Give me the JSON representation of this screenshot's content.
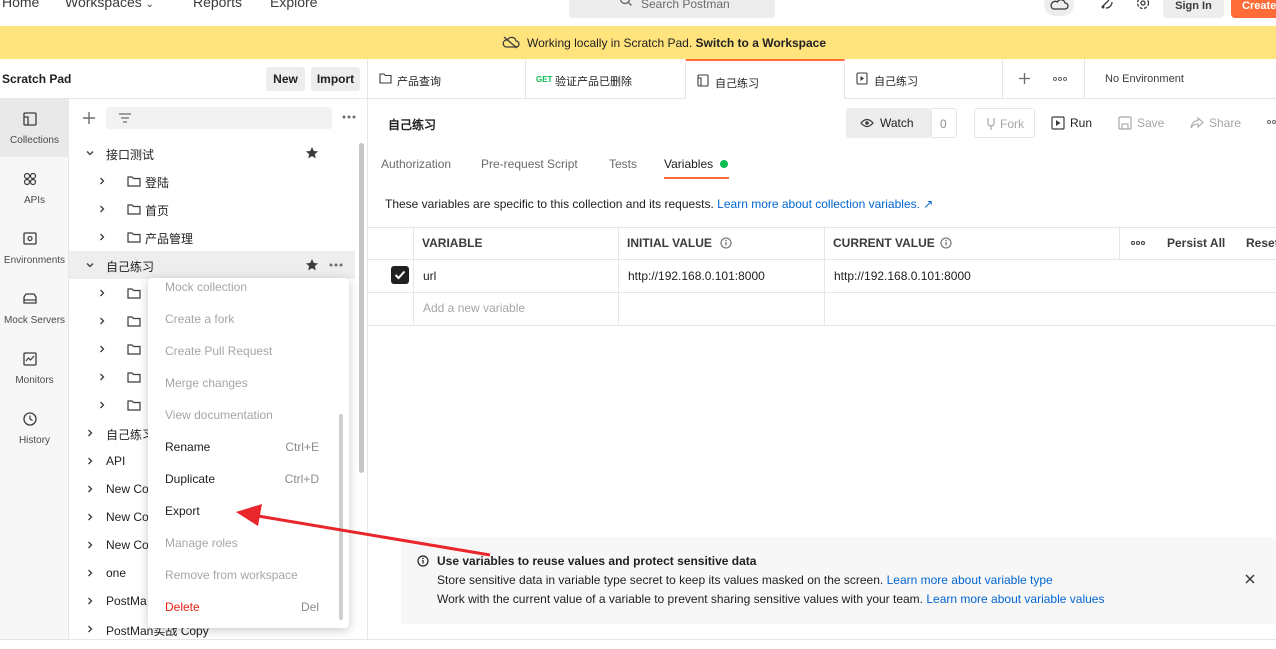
{
  "colors": {
    "accent": "#ff6c37",
    "banner": "#ffe47e",
    "link": "#0265d2",
    "success": "#0cbb52",
    "danger": "#eb2013",
    "annotation_arrow": "#e8262c"
  },
  "nav": {
    "home": "Home",
    "workspaces": "Workspaces",
    "reports": "Reports",
    "explore": "Explore",
    "search_placeholder": "Search Postman",
    "sign_in": "Sign In",
    "create": "Create"
  },
  "banner": {
    "text": "Working locally in Scratch Pad.",
    "link": "Switch to a Workspace"
  },
  "sidebar": {
    "title": "Scratch Pad",
    "new_label": "New",
    "import_label": "Import",
    "rail": [
      {
        "label": "Collections",
        "icon": "collections-icon"
      },
      {
        "label": "APIs",
        "icon": "apis-icon"
      },
      {
        "label": "Environments",
        "icon": "environments-icon"
      },
      {
        "label": "Mock Servers",
        "icon": "mock-servers-icon"
      },
      {
        "label": "Monitors",
        "icon": "monitors-icon"
      },
      {
        "label": "History",
        "icon": "history-icon"
      }
    ],
    "tree": [
      {
        "label": "接口测试"
      },
      {
        "label": "登陆"
      },
      {
        "label": "首页"
      },
      {
        "label": "产品管理"
      },
      {
        "label": "自己练习"
      },
      {
        "label": "自己练习"
      },
      {
        "label": "API"
      },
      {
        "label": "New Co"
      },
      {
        "label": "New Co"
      },
      {
        "label": "New Co"
      },
      {
        "label": "one"
      },
      {
        "label": "PostMa"
      },
      {
        "label": "PostMan实战 Copy"
      }
    ]
  },
  "context_menu": {
    "items": [
      {
        "label": "Mock collection",
        "shortcut": ""
      },
      {
        "label": "Create a fork",
        "shortcut": ""
      },
      {
        "label": "Create Pull Request",
        "shortcut": ""
      },
      {
        "label": "Merge changes",
        "shortcut": ""
      },
      {
        "label": "View documentation",
        "shortcut": ""
      },
      {
        "label": "Rename",
        "shortcut": "Ctrl+E"
      },
      {
        "label": "Duplicate",
        "shortcut": "Ctrl+D"
      },
      {
        "label": "Export",
        "shortcut": ""
      },
      {
        "label": "Manage roles",
        "shortcut": ""
      },
      {
        "label": "Remove from workspace",
        "shortcut": ""
      },
      {
        "label": "Delete",
        "shortcut": "Del"
      }
    ]
  },
  "tabs": [
    {
      "label": "产品查询",
      "method": ""
    },
    {
      "label": "验证产品已删除",
      "method": "GET"
    },
    {
      "label": "自己练习",
      "method": ""
    },
    {
      "label": "自己练习",
      "method": ""
    }
  ],
  "environment": "No Environment",
  "collection": {
    "title": "自己练习",
    "watch": "Watch",
    "watch_count": "0",
    "fork": "Fork",
    "run": "Run",
    "save": "Save",
    "share": "Share"
  },
  "inner_tabs": {
    "authorization": "Authorization",
    "prerequest": "Pre-request Script",
    "tests": "Tests",
    "variables": "Variables"
  },
  "variables": {
    "description": "These variables are specific to this collection and its requests.",
    "learn_more": "Learn more about collection variables. ↗",
    "headers": {
      "variable": "VARIABLE",
      "initial": "INITIAL VALUE",
      "current": "CURRENT VALUE",
      "persist_all": "Persist All",
      "reset": "Reset"
    },
    "rows": [
      {
        "name": "url",
        "initial": "http://192.168.0.101:8000",
        "current": "http://192.168.0.101:8000"
      }
    ],
    "add_placeholder": "Add a new variable"
  },
  "info": {
    "title": "Use variables to reuse values and protect sensitive data",
    "line1": "Store sensitive data in variable type secret to keep its values masked on the screen.",
    "link1": "Learn more about variable type",
    "line2": "Work with the current value of a variable to prevent sharing sensitive values with your team.",
    "link2": "Learn more about variable values"
  }
}
